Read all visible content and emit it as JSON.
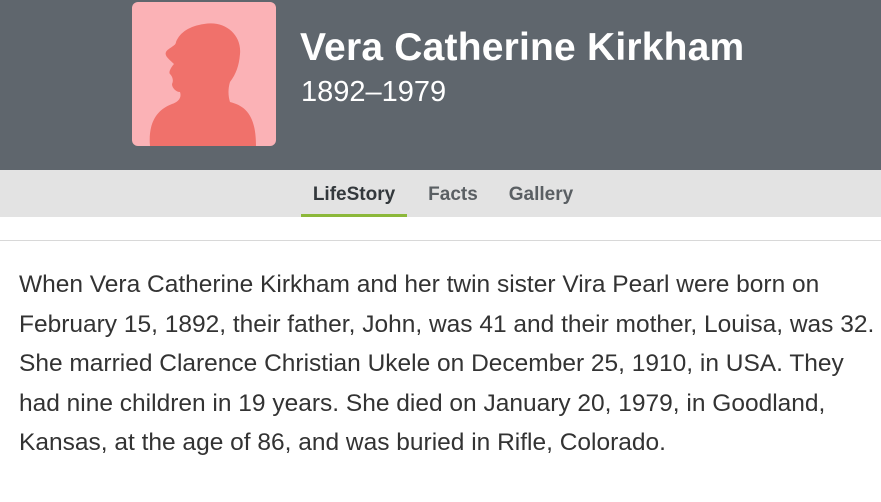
{
  "person": {
    "name": "Vera Catherine Kirkham",
    "lifespan": "1892–1979"
  },
  "tabs": [
    {
      "label": "LifeStory",
      "active": true
    },
    {
      "label": "Facts",
      "active": false
    },
    {
      "label": "Gallery",
      "active": false
    }
  ],
  "story": {
    "text": "When Vera Catherine Kirkham and her twin sister Vira Pearl were born on February 15, 1892, their father, John, was 41 and their mother, Louisa, was 32. She married Clarence Christian Ukele on December 25, 1910, in USA. They had nine children in 19 years. She died on January 20, 1979, in Goodland, Kansas, at the age of 86, and was buried in Rifle, Colorado."
  },
  "colors": {
    "header_bg": "#5f666d",
    "portrait_bg": "#fbb2b6",
    "silhouette": "#f0716b",
    "tab_active_underline": "#8cb83a"
  },
  "icons": {
    "portrait": "female-silhouette-icon"
  }
}
